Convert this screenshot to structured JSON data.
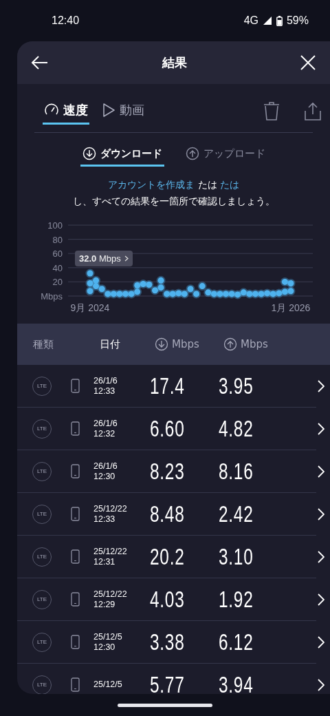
{
  "status_bar": {
    "time": "12:40",
    "network": "4G",
    "battery": "59%"
  },
  "header": {
    "title": "結果"
  },
  "tabs": [
    {
      "label": "速度",
      "kind": "speed",
      "selected": true
    },
    {
      "label": "動画",
      "kind": "video",
      "selected": false
    }
  ],
  "subtabs": [
    {
      "label": "ダウンロード",
      "kind": "download",
      "selected": true
    },
    {
      "label": "アップロード",
      "kind": "upload",
      "selected": false
    }
  ],
  "promo": {
    "lines": [
      [
        {
          "text": "アカウントを作成ま",
          "link": true
        },
        {
          "text": "たは",
          "link": false
        },
        {
          "text": "たは",
          "link": true
        }
      ],
      [
        {
          "text": "し、すべての結果を一箇所で確認しましょう。",
          "link": false
        }
      ]
    ]
  },
  "chart": {
    "tooltip": "**32.0** Mbps",
    "chart_data": {
      "type": "scatter",
      "grid": true,
      "ylabel": "Mbps",
      "ylim": [
        0,
        100
      ],
      "yticks": [
        20,
        40,
        60,
        80,
        100
      ],
      "categories": [
        "9月 2024",
        null,
        null,
        null,
        null,
        null,
        null,
        null,
        null,
        null,
        null,
        null,
        null,
        null,
        null,
        null,
        null,
        null,
        null,
        null,
        null,
        null,
        null,
        null,
        null,
        null,
        null,
        null,
        null,
        null,
        null,
        null,
        null,
        null,
        "1月 2026"
      ],
      "series": [
        {
          "color": "#4fb3ee",
          "values": [
            32,
            22,
            10,
            3,
            3,
            3,
            3,
            3,
            15,
            17,
            16,
            8,
            22,
            3,
            3,
            4,
            3,
            10,
            3,
            14,
            5,
            3,
            3,
            3,
            3,
            2,
            5,
            3,
            3,
            3,
            4,
            3,
            4,
            20,
            18
          ]
        },
        {
          "color": "#4fb3ee",
          "values": [
            18,
            14,
            null,
            null,
            null,
            null,
            null,
            null,
            6,
            null,
            null,
            null,
            12,
            null,
            null,
            null,
            null,
            null,
            null,
            null,
            null,
            null,
            null,
            null,
            null,
            null,
            null,
            null,
            null,
            null,
            null,
            null,
            null,
            6,
            7
          ]
        },
        {
          "color": "#4fb3ee",
          "values": [
            7,
            null,
            null,
            null,
            null,
            null,
            null,
            null,
            null,
            null,
            null,
            null,
            null,
            null,
            null,
            null,
            null,
            null,
            null,
            null,
            null,
            null,
            null,
            null,
            null,
            null,
            null,
            null,
            null,
            null,
            null,
            null,
            null,
            null,
            null
          ]
        }
      ]
    }
  },
  "table": {
    "columns": [
      {
        "label": "種類",
        "kind": "text",
        "selected": false
      },
      {
        "label": "日付",
        "kind": "text",
        "selected": true
      },
      {
        "label": "Mbps",
        "kind": "download",
        "selected": false
      },
      {
        "label": "Mbps",
        "kind": "upload",
        "selected": false
      }
    ],
    "rows": [
      {
        "type": "LTE",
        "date": "26/1/6",
        "time": "12:33",
        "down": "17.4",
        "up": "3.95"
      },
      {
        "type": "LTE",
        "date": "26/1/6",
        "time": "12:32",
        "down": "6.60",
        "up": "4.82"
      },
      {
        "type": "LTE",
        "date": "26/1/6",
        "time": "12:30",
        "down": "8.23",
        "up": "8.16"
      },
      {
        "type": "LTE",
        "date": "25/12/22",
        "time": "12:33",
        "down": "8.48",
        "up": "2.42"
      },
      {
        "type": "LTE",
        "date": "25/12/22",
        "time": "12:31",
        "down": "20.2",
        "up": "3.10"
      },
      {
        "type": "LTE",
        "date": "25/12/22",
        "time": "12:29",
        "down": "4.03",
        "up": "1.92"
      },
      {
        "type": "LTE",
        "date": "25/12/5",
        "time": "12:30",
        "down": "3.38",
        "up": "6.12"
      },
      {
        "type": "LTE",
        "date": "25/12/5",
        "down": "5.77",
        "up": "3.94"
      }
    ]
  }
}
